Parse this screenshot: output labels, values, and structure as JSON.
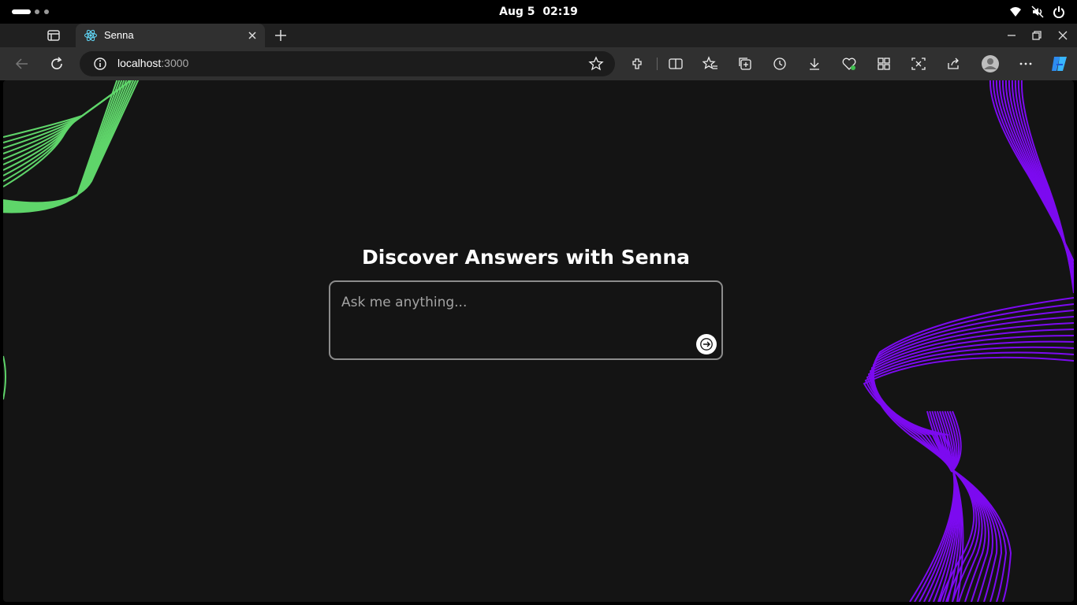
{
  "system_bar": {
    "date": "Aug 5",
    "time": "02:19",
    "icons": [
      "wifi-icon",
      "volume-muted-icon",
      "power-icon"
    ]
  },
  "browser": {
    "tab": {
      "title": "Senna",
      "favicon": "react-logo-icon"
    },
    "address": {
      "host": "localhost",
      "port": ":3000"
    },
    "toolbar_icons": [
      "extensions-icon",
      "split-screen-icon",
      "favorites-icon",
      "collections-icon",
      "history-icon",
      "downloads-icon",
      "browser-essentials-icon",
      "apps-icon",
      "screenshot-icon",
      "share-icon",
      "profile-icon",
      "more-icon",
      "copilot-icon"
    ]
  },
  "main": {
    "heading": "Discover Answers with Senna",
    "prompt": {
      "placeholder": "Ask me anything...",
      "value": ""
    }
  },
  "colors": {
    "accent_green": "#5fd56a",
    "accent_purple": "#7c0af0",
    "page_bg": "#141414"
  }
}
